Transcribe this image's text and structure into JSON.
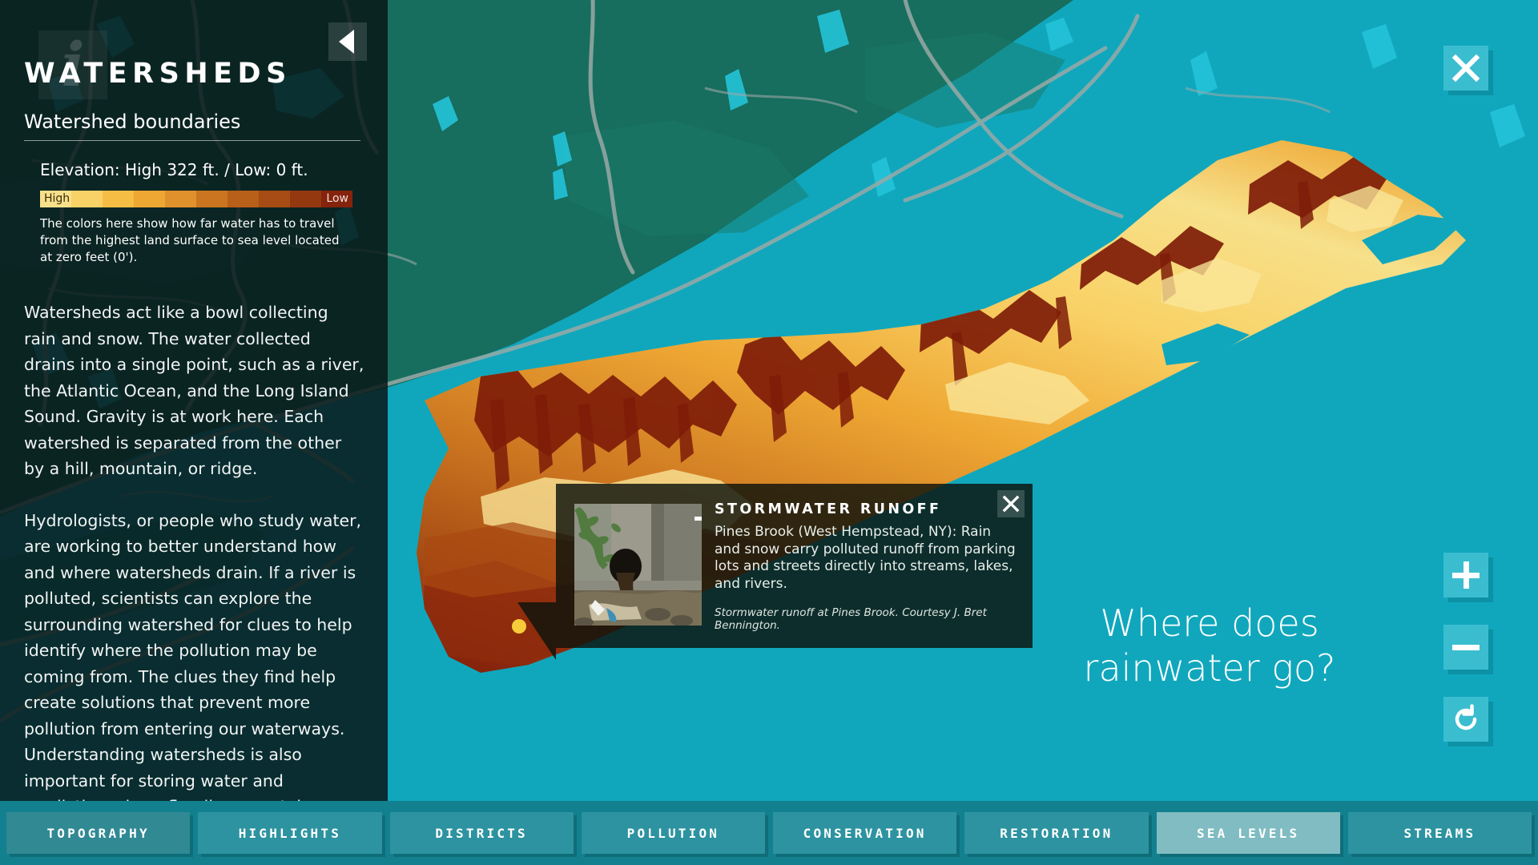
{
  "app": {
    "background_color": "#10a7bd",
    "sidebar_color": "#081818",
    "accent_color": "#3bbdd0",
    "tabbar_color": "#12808f"
  },
  "sidebar": {
    "info_icon_glyph": "i",
    "collapse_icon": "triangle-left-icon",
    "title": "WATERSHEDS",
    "subtitle": "Watershed boundaries",
    "legend": {
      "range_label": "Elevation: High 322 ft. / Low: 0 ft.",
      "high_label": "High",
      "low_label": "Low",
      "swatches": [
        "#f7e08a",
        "#f9d267",
        "#f6bd45",
        "#eea733",
        "#e0912c",
        "#cb7520",
        "#b85f19",
        "#a64c14",
        "#94380f",
        "#85230c"
      ],
      "note": "The colors here show how far water has to travel from the highest land surface to sea level located at zero feet (0')."
    },
    "paragraphs": [
      "Watersheds act like a bowl collecting rain and snow. The water collected drains into a single point, such as a river, the Atlantic Ocean, and the Long Island Sound. Gravity is at work here. Each watershed is separated from the other by a hill, mountain, or ridge.",
      "Hydrologists, or people who study water, are working to better understand how and where watersheds drain. If a river is polluted, scientists can explore the surrounding watershed for clues to help identify where the pollution may be coming from. The clues they find help create solutions that prevent more pollution from entering our waterways. Understanding watersheds is also important for storing water and predicting where flooding may take place after a storm."
    ]
  },
  "map": {
    "question": "Where does\nrainwater go?",
    "close_icon": "close-x-icon",
    "zoom_in_icon": "plus-icon",
    "zoom_out_icon": "minus-icon",
    "reset_icon": "reset-rotate-icon",
    "marker_color": "#f6cc3a"
  },
  "popup": {
    "title": "STORMWATER RUNOFF",
    "body": "Pines Brook (West Hempstead, NY): Rain and snow carry polluted runoff from parking lots and streets directly into streams, lakes, and rivers.",
    "credit": "Stormwater runoff at Pines Brook. Courtesy J. Bret Bennington.",
    "close_icon": "close-x-icon",
    "expand_icon": "plus-icon",
    "photo_alt": "storm drain pipe discharging runoff"
  },
  "tabs": [
    {
      "label": "TOPOGRAPHY",
      "state": "dim"
    },
    {
      "label": "HIGHLIGHTS",
      "state": "normal"
    },
    {
      "label": "DISTRICTS",
      "state": "normal"
    },
    {
      "label": "POLLUTION",
      "state": "normal"
    },
    {
      "label": "CONSERVATION",
      "state": "normal"
    },
    {
      "label": "RESTORATION",
      "state": "normal"
    },
    {
      "label": "SEA LEVELS",
      "state": "active"
    },
    {
      "label": "STREAMS",
      "state": "normal"
    }
  ]
}
